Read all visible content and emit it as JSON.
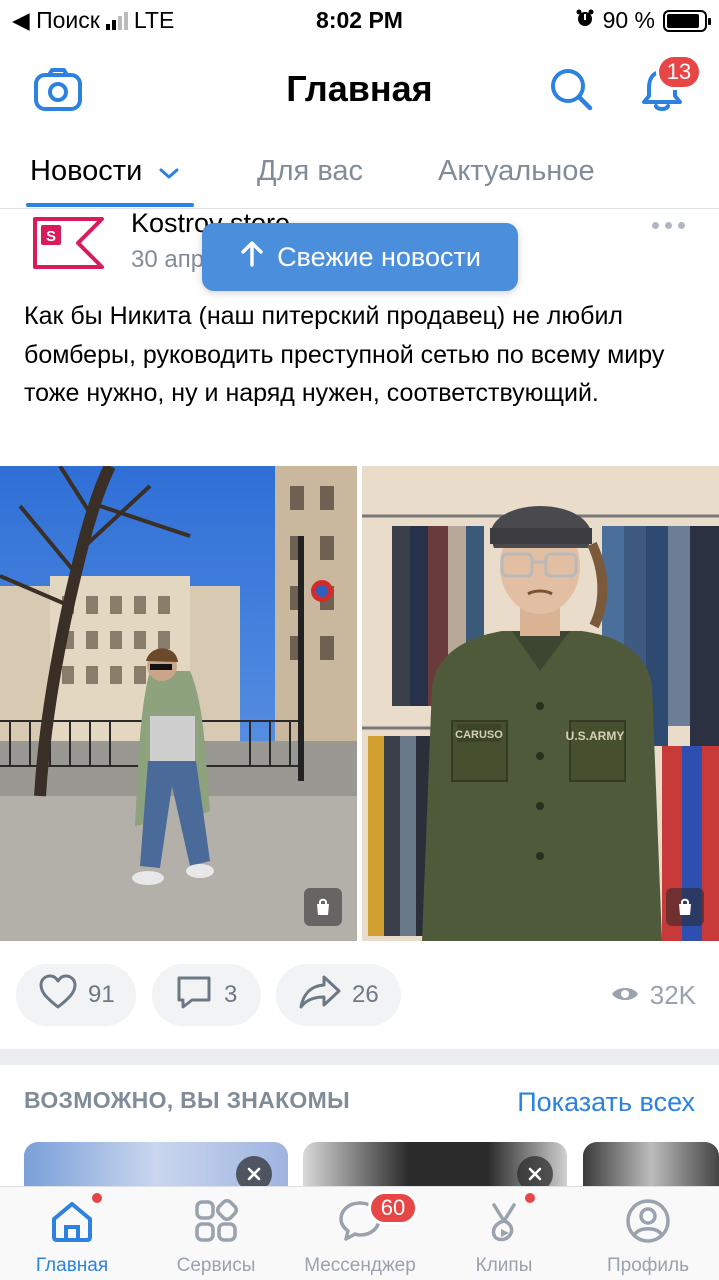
{
  "status_bar": {
    "back_app": "◀ Поиск",
    "network": "LTE",
    "time": "8:02 PM",
    "battery": "90 %"
  },
  "header": {
    "title": "Главная",
    "notifications_count": "13"
  },
  "tabs": [
    {
      "label": "Новости",
      "active": true
    },
    {
      "label": "Для вас",
      "active": false
    },
    {
      "label": "Актуальное",
      "active": false
    }
  ],
  "fresh_news_button": "Свежие новости",
  "post": {
    "author": "Kostrov store",
    "date": "30 апреля",
    "text": "Как бы Никита (наш питерский продавец) не любил бомберы, руководить преступной сетью по всему миру тоже нужно, ну и наряд нужен, соответствующий.",
    "photo_text": [
      "CARUSO",
      "U.S.ARMY"
    ],
    "likes": "91",
    "comments": "3",
    "shares": "26",
    "views": "32K"
  },
  "people_section": {
    "title": "ВОЗМОЖНО, ВЫ ЗНАКОМЫ",
    "show_all": "Показать всех"
  },
  "tab_bar": [
    {
      "label": "Главная",
      "icon": "home-icon",
      "active": true
    },
    {
      "label": "Сервисы",
      "icon": "services-icon",
      "active": false
    },
    {
      "label": "Мессенджер",
      "icon": "messenger-icon",
      "badge": "60",
      "active": false
    },
    {
      "label": "Клипы",
      "icon": "clips-icon",
      "active": false
    },
    {
      "label": "Профиль",
      "icon": "profile-icon",
      "active": false
    }
  ],
  "colors": {
    "accent": "#2d81e0",
    "badge": "#e64646",
    "fresh_button": "#4b8fdc",
    "logo": "#d81b5a"
  }
}
